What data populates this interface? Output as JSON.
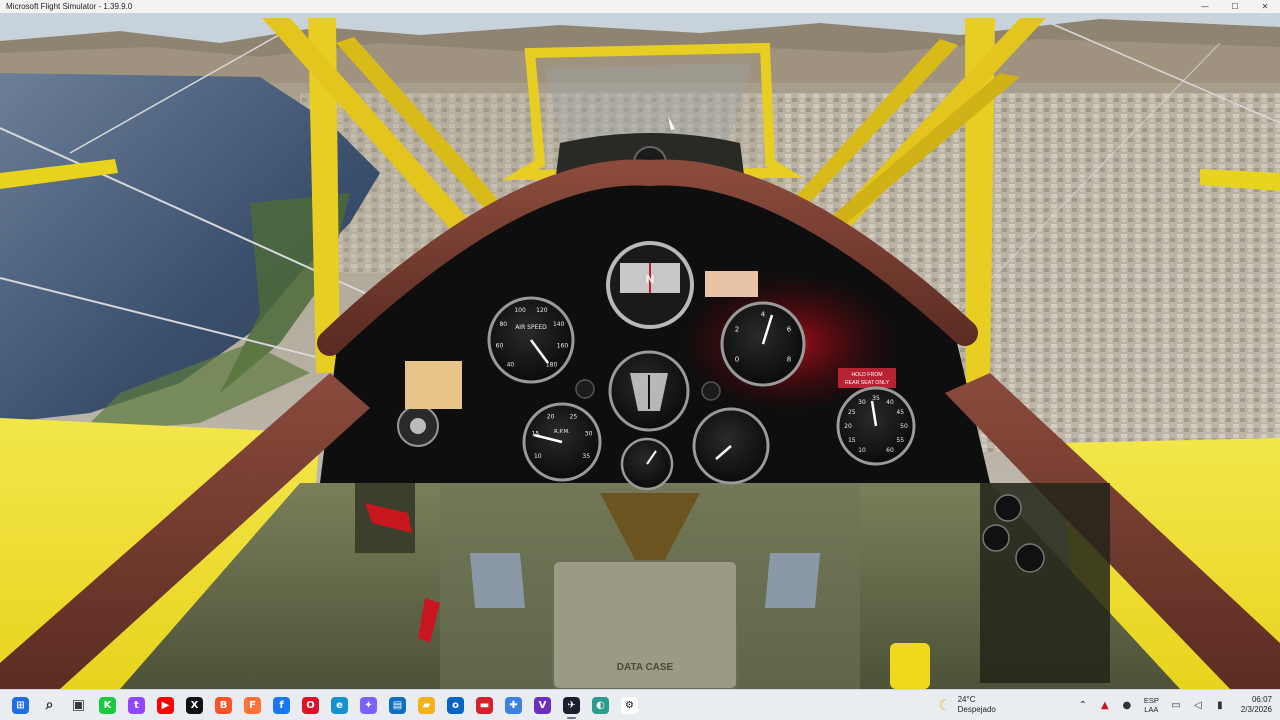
{
  "window": {
    "title": "Microsoft Flight Simulator - 1.39.9.0",
    "controls": {
      "minimize": "—",
      "maximize": "☐",
      "close": "✕"
    }
  },
  "cockpit": {
    "airspeed_label": "AIR SPEED",
    "rpm_label": "R.P.M.",
    "placard_rear_seat": [
      "HOLD FROM",
      "REAR SEAT ONLY"
    ],
    "compass_heading": "N",
    "box_label": "DATA CASE",
    "airspeed_ticks": [
      "40",
      "60",
      "80",
      "100",
      "120",
      "140",
      "160",
      "180"
    ],
    "altimeter_ticks": [
      "0",
      "2",
      "4",
      "6",
      "8"
    ],
    "tach_ticks": [
      "10",
      "15",
      "20",
      "25",
      "30",
      "35"
    ],
    "right_gauge_ticks": [
      "10",
      "15",
      "20",
      "25",
      "30",
      "35",
      "40",
      "45",
      "50",
      "55",
      "60"
    ]
  },
  "taskbar": {
    "apps": [
      {
        "name": "start",
        "glyph": "⊞",
        "color": "#1f6fe0"
      },
      {
        "name": "search",
        "glyph": "⌕",
        "color": "#2d2d2d"
      },
      {
        "name": "task-view",
        "glyph": "▣",
        "color": "#3a3a3a"
      },
      {
        "name": "kick",
        "glyph": "K",
        "color": "#19c940"
      },
      {
        "name": "twitch",
        "glyph": "t",
        "color": "#9146ff"
      },
      {
        "name": "youtube",
        "glyph": "▶",
        "color": "#ff0000"
      },
      {
        "name": "x",
        "glyph": "X",
        "color": "#111111"
      },
      {
        "name": "brave",
        "glyph": "B",
        "color": "#fb542b"
      },
      {
        "name": "firefox",
        "glyph": "F",
        "color": "#ff7139"
      },
      {
        "name": "facebook",
        "glyph": "f",
        "color": "#1877f2"
      },
      {
        "name": "opera",
        "glyph": "O",
        "color": "#e0102a"
      },
      {
        "name": "edge",
        "glyph": "e",
        "color": "#1590d0"
      },
      {
        "name": "copilot",
        "glyph": "✦",
        "color": "#7b61ff"
      },
      {
        "name": "remote-desktop",
        "glyph": "▤",
        "color": "#0b6fc2"
      },
      {
        "name": "file-explorer",
        "glyph": "▰",
        "color": "#f3b11b"
      },
      {
        "name": "outlook",
        "glyph": "o",
        "color": "#0a64c4"
      },
      {
        "name": "media-app",
        "glyph": "▬",
        "color": "#d4222b"
      },
      {
        "name": "snipping-tool",
        "glyph": "✚",
        "color": "#3b82e0"
      },
      {
        "name": "visual-studio",
        "glyph": "V",
        "color": "#6b2fbf"
      },
      {
        "name": "flight-simulator",
        "glyph": "✈",
        "color": "#1a1f2e"
      },
      {
        "name": "browser-alt",
        "glyph": "◐",
        "color": "#2a9d8f"
      },
      {
        "name": "chatgpt",
        "glyph": "⚙",
        "color": "#ffffff"
      }
    ],
    "weather": {
      "temp": "24°C",
      "condition": "Despejado"
    },
    "language": {
      "line1": "ESP",
      "line2": "LAA"
    },
    "clock": {
      "time": "06:07",
      "date": "2/3/2026"
    }
  }
}
